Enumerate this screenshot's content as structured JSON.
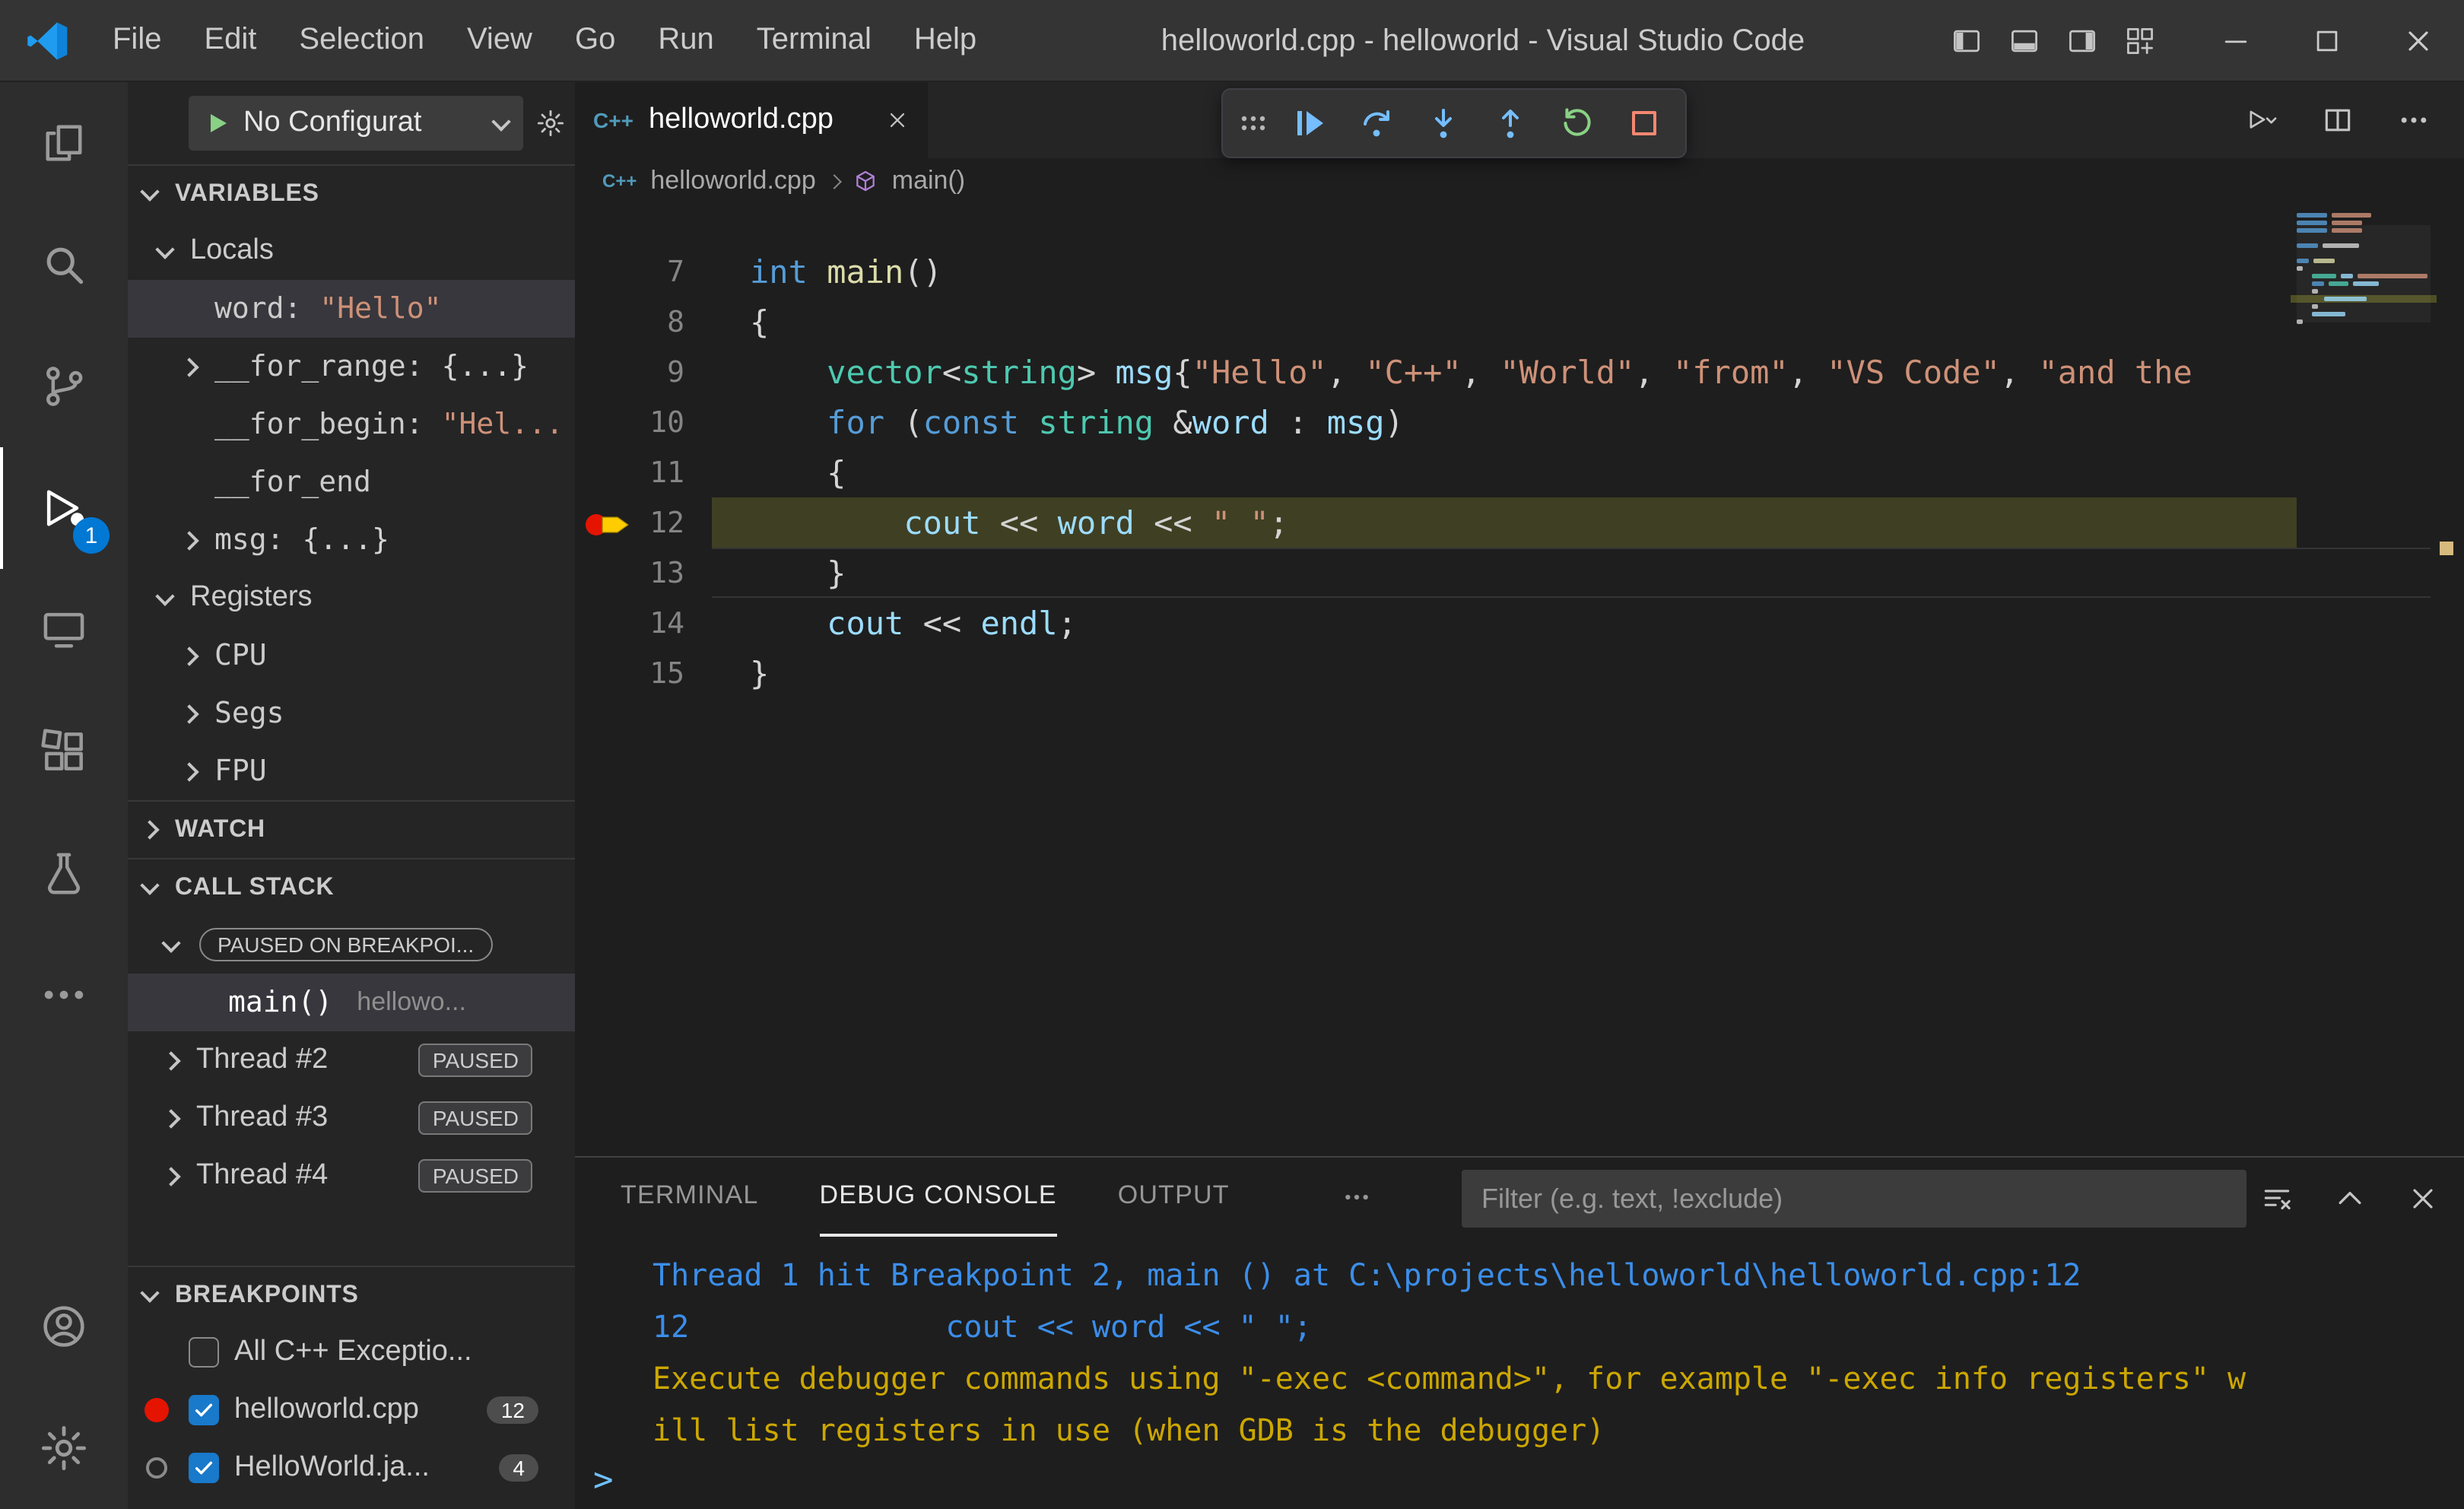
{
  "colors": {
    "accent": "#007acc",
    "keyword": "#569cd6",
    "type": "#4ec9b0",
    "variable": "#9cdcfe",
    "string": "#ce9178",
    "function": "#dcdcaa",
    "console_info": "#3b8eea",
    "console_warn": "#cca700",
    "debug_blue": "#75beff",
    "debug_green": "#89d185",
    "debug_red": "#f48771",
    "badge_blue": "#0078d4",
    "breakpoint_red": "#e51400",
    "current_line_arrow": "#ffcc00",
    "selection_row": "#37373d"
  },
  "title_bar": {
    "menus": [
      "File",
      "Edit",
      "Selection",
      "View",
      "Go",
      "Run",
      "Terminal",
      "Help"
    ],
    "title": "helloworld.cpp - helloworld - Visual Studio Code"
  },
  "activity_bar": {
    "items": [
      {
        "name": "explorer",
        "icon": "files"
      },
      {
        "name": "search",
        "icon": "search"
      },
      {
        "name": "source-control",
        "icon": "scm"
      },
      {
        "name": "run-and-debug",
        "icon": "debug",
        "active": true,
        "badge": "1"
      },
      {
        "name": "remote-explorer",
        "icon": "remote"
      },
      {
        "name": "extensions",
        "icon": "extensions"
      },
      {
        "name": "testing",
        "icon": "beaker"
      },
      {
        "name": "more",
        "icon": "ellipsis"
      }
    ],
    "bottom": [
      {
        "name": "accounts",
        "icon": "account"
      },
      {
        "name": "settings",
        "icon": "gear"
      }
    ]
  },
  "sidebar": {
    "toolbar": {
      "config_label": "No Configurat"
    },
    "variables": {
      "header": "VARIABLES",
      "locals_header": "Locals",
      "locals": [
        {
          "name": "word:",
          "value": "\"Hello\"",
          "kind": "string",
          "selected": true,
          "twistie": "none"
        },
        {
          "name": "__for_range:",
          "value": "{...}",
          "kind": "object",
          "selected": false,
          "twistie": "closed"
        },
        {
          "name": "__for_begin:",
          "value": "\"Hel...",
          "kind": "string",
          "selected": false,
          "twistie": "none"
        },
        {
          "name": "__for_end",
          "value": "",
          "kind": "none",
          "selected": false,
          "twistie": "none"
        },
        {
          "name": "msg:",
          "value": "{...}",
          "kind": "object",
          "selected": false,
          "twistie": "closed"
        }
      ],
      "registers_header": "Registers",
      "registers": [
        {
          "name": "CPU"
        },
        {
          "name": "Segs"
        },
        {
          "name": "FPU"
        }
      ]
    },
    "watch": {
      "header": "WATCH"
    },
    "call_stack": {
      "header": "CALL STACK",
      "status_badge": "PAUSED ON BREAKPOI...",
      "frame": {
        "name": "main()",
        "detail": "hellowo..."
      },
      "threads": [
        {
          "name": "Thread #2",
          "badge": "PAUSED"
        },
        {
          "name": "Thread #3",
          "badge": "PAUSED"
        },
        {
          "name": "Thread #4",
          "badge": "PAUSED"
        }
      ]
    },
    "breakpoints": {
      "header": "BREAKPOINTS",
      "items": [
        {
          "label": "All C++ Exceptio...",
          "checked": false,
          "icon": "none",
          "count": ""
        },
        {
          "label": "helloworld.cpp",
          "checked": true,
          "icon": "red-dot",
          "count": "12"
        },
        {
          "label": "HelloWorld.ja...",
          "checked": true,
          "icon": "gray-circle",
          "count": "4"
        }
      ]
    }
  },
  "editor": {
    "tab": {
      "label": "helloworld.cpp",
      "icon_text": "C++"
    },
    "breadcrumb": {
      "file": "helloworld.cpp",
      "symbol": "main()"
    },
    "debug_toolbar": [
      {
        "name": "drag-handle",
        "icon": "drag",
        "color": "gray"
      },
      {
        "name": "continue",
        "icon": "continue",
        "color": "blue"
      },
      {
        "name": "step-over",
        "icon": "stepover",
        "color": "blue"
      },
      {
        "name": "step-into",
        "icon": "stepinto",
        "color": "blue"
      },
      {
        "name": "step-out",
        "icon": "stepout",
        "color": "blue"
      },
      {
        "name": "restart",
        "icon": "restart",
        "color": "green"
      },
      {
        "name": "stop",
        "icon": "stop",
        "color": "red"
      }
    ],
    "actions": [
      {
        "name": "run-or-debug",
        "icon": "runchev"
      },
      {
        "name": "split-editor",
        "icon": "split"
      },
      {
        "name": "more-actions",
        "icon": "ellipsis"
      }
    ],
    "lines": [
      {
        "num": "7",
        "tokens": [
          {
            "c": "kw",
            "t": "int"
          },
          {
            "c": "pl",
            "t": " "
          },
          {
            "c": "fn",
            "t": "main"
          },
          {
            "c": "pl",
            "t": "()"
          }
        ]
      },
      {
        "num": "8",
        "tokens": [
          {
            "c": "pl",
            "t": "{"
          }
        ]
      },
      {
        "num": "9",
        "tokens": [
          {
            "c": "pl",
            "t": "    "
          },
          {
            "c": "type",
            "t": "vector"
          },
          {
            "c": "pl",
            "t": "<"
          },
          {
            "c": "type",
            "t": "string"
          },
          {
            "c": "pl",
            "t": "> "
          },
          {
            "c": "var",
            "t": "msg"
          },
          {
            "c": "pl",
            "t": "{"
          },
          {
            "c": "str",
            "t": "\"Hello\""
          },
          {
            "c": "pl",
            "t": ", "
          },
          {
            "c": "str",
            "t": "\"C++\""
          },
          {
            "c": "pl",
            "t": ", "
          },
          {
            "c": "str",
            "t": "\"World\""
          },
          {
            "c": "pl",
            "t": ", "
          },
          {
            "c": "str",
            "t": "\"from\""
          },
          {
            "c": "pl",
            "t": ", "
          },
          {
            "c": "str",
            "t": "\"VS Code\""
          },
          {
            "c": "pl",
            "t": ", "
          },
          {
            "c": "str",
            "t": "\"and the"
          }
        ]
      },
      {
        "num": "10",
        "tokens": [
          {
            "c": "pl",
            "t": "    "
          },
          {
            "c": "kw",
            "t": "for"
          },
          {
            "c": "pl",
            "t": " ("
          },
          {
            "c": "kw",
            "t": "const"
          },
          {
            "c": "pl",
            "t": " "
          },
          {
            "c": "type",
            "t": "string"
          },
          {
            "c": "pl",
            "t": " &"
          },
          {
            "c": "var",
            "t": "word"
          },
          {
            "c": "pl",
            "t": " : "
          },
          {
            "c": "var",
            "t": "msg"
          },
          {
            "c": "pl",
            "t": ")"
          }
        ]
      },
      {
        "num": "11",
        "tokens": [
          {
            "c": "pl",
            "t": "    {"
          }
        ]
      },
      {
        "num": "12",
        "current": true,
        "tokens": [
          {
            "c": "pl",
            "t": "        "
          },
          {
            "c": "var",
            "t": "cout"
          },
          {
            "c": "pl",
            "t": " << "
          },
          {
            "c": "var",
            "t": "word"
          },
          {
            "c": "pl",
            "t": " << "
          },
          {
            "c": "str",
            "t": "\" \""
          },
          {
            "c": "pl",
            "t": ";"
          }
        ]
      },
      {
        "num": "13",
        "cursor": true,
        "tokens": [
          {
            "c": "pl",
            "t": "    }"
          }
        ]
      },
      {
        "num": "14",
        "tokens": [
          {
            "c": "pl",
            "t": "    "
          },
          {
            "c": "var",
            "t": "cout"
          },
          {
            "c": "pl",
            "t": " << "
          },
          {
            "c": "var",
            "t": "endl"
          },
          {
            "c": "pl",
            "t": ";"
          }
        ]
      },
      {
        "num": "15",
        "tokens": [
          {
            "c": "pl",
            "t": "}"
          }
        ]
      }
    ],
    "minimap_rows": [
      {
        "x": 0,
        "segs": [
          {
            "c": "kw",
            "w": 20
          },
          {
            "c": "str",
            "w": 26
          }
        ]
      },
      {
        "x": 0,
        "segs": [
          {
            "c": "kw",
            "w": 20
          },
          {
            "c": "str",
            "w": 20
          }
        ]
      },
      {
        "x": 0,
        "segs": [
          {
            "c": "kw",
            "w": 20
          },
          {
            "c": "str",
            "w": 20
          }
        ]
      },
      {
        "x": 0,
        "segs": []
      },
      {
        "x": 0,
        "segs": [
          {
            "c": "kw",
            "w": 14
          },
          {
            "c": "pl",
            "w": 24
          }
        ]
      },
      {
        "x": 0,
        "segs": []
      },
      {
        "x": 0,
        "segs": [
          {
            "c": "kw",
            "w": 8
          },
          {
            "c": "fn",
            "w": 14
          }
        ]
      },
      {
        "x": 0,
        "segs": [
          {
            "c": "pl",
            "w": 4
          }
        ]
      },
      {
        "x": 10,
        "segs": [
          {
            "c": "type",
            "w": 16
          },
          {
            "c": "var",
            "w": 8
          },
          {
            "c": "str",
            "w": 46
          }
        ]
      },
      {
        "x": 10,
        "segs": [
          {
            "c": "kw",
            "w": 8
          },
          {
            "c": "type",
            "w": 13
          },
          {
            "c": "var",
            "w": 17
          }
        ]
      },
      {
        "x": 10,
        "segs": [
          {
            "c": "pl",
            "w": 4
          }
        ]
      },
      {
        "x": 18,
        "hl": true,
        "segs": [
          {
            "c": "var",
            "w": 28
          }
        ]
      },
      {
        "x": 10,
        "segs": [
          {
            "c": "pl",
            "w": 4
          }
        ]
      },
      {
        "x": 10,
        "segs": [
          {
            "c": "var",
            "w": 22
          }
        ]
      },
      {
        "x": 0,
        "segs": [
          {
            "c": "pl",
            "w": 4
          }
        ]
      }
    ]
  },
  "panel": {
    "tabs": [
      "TERMINAL",
      "DEBUG CONSOLE",
      "OUTPUT"
    ],
    "active_tab": "DEBUG CONSOLE",
    "filter_placeholder": "Filter (e.g. text, !exclude)",
    "actions": [
      {
        "name": "clear-console",
        "icon": "clearall"
      },
      {
        "name": "maximize-panel",
        "icon": "chevup"
      },
      {
        "name": "close-panel",
        "icon": "cross"
      }
    ],
    "console": [
      {
        "kind": "info",
        "text": "Thread 1 hit Breakpoint 2, main () at C:\\projects\\helloworld\\helloworld.cpp:12"
      },
      {
        "kind": "info",
        "text": "12              cout << word << \" \";"
      },
      {
        "kind": "warn",
        "text": "Execute debugger commands using \"-exec <command>\", for example \"-exec info registers\" w"
      },
      {
        "kind": "warn",
        "text": "ill list registers in use (when GDB is the debugger)"
      }
    ],
    "prompt": ">"
  }
}
